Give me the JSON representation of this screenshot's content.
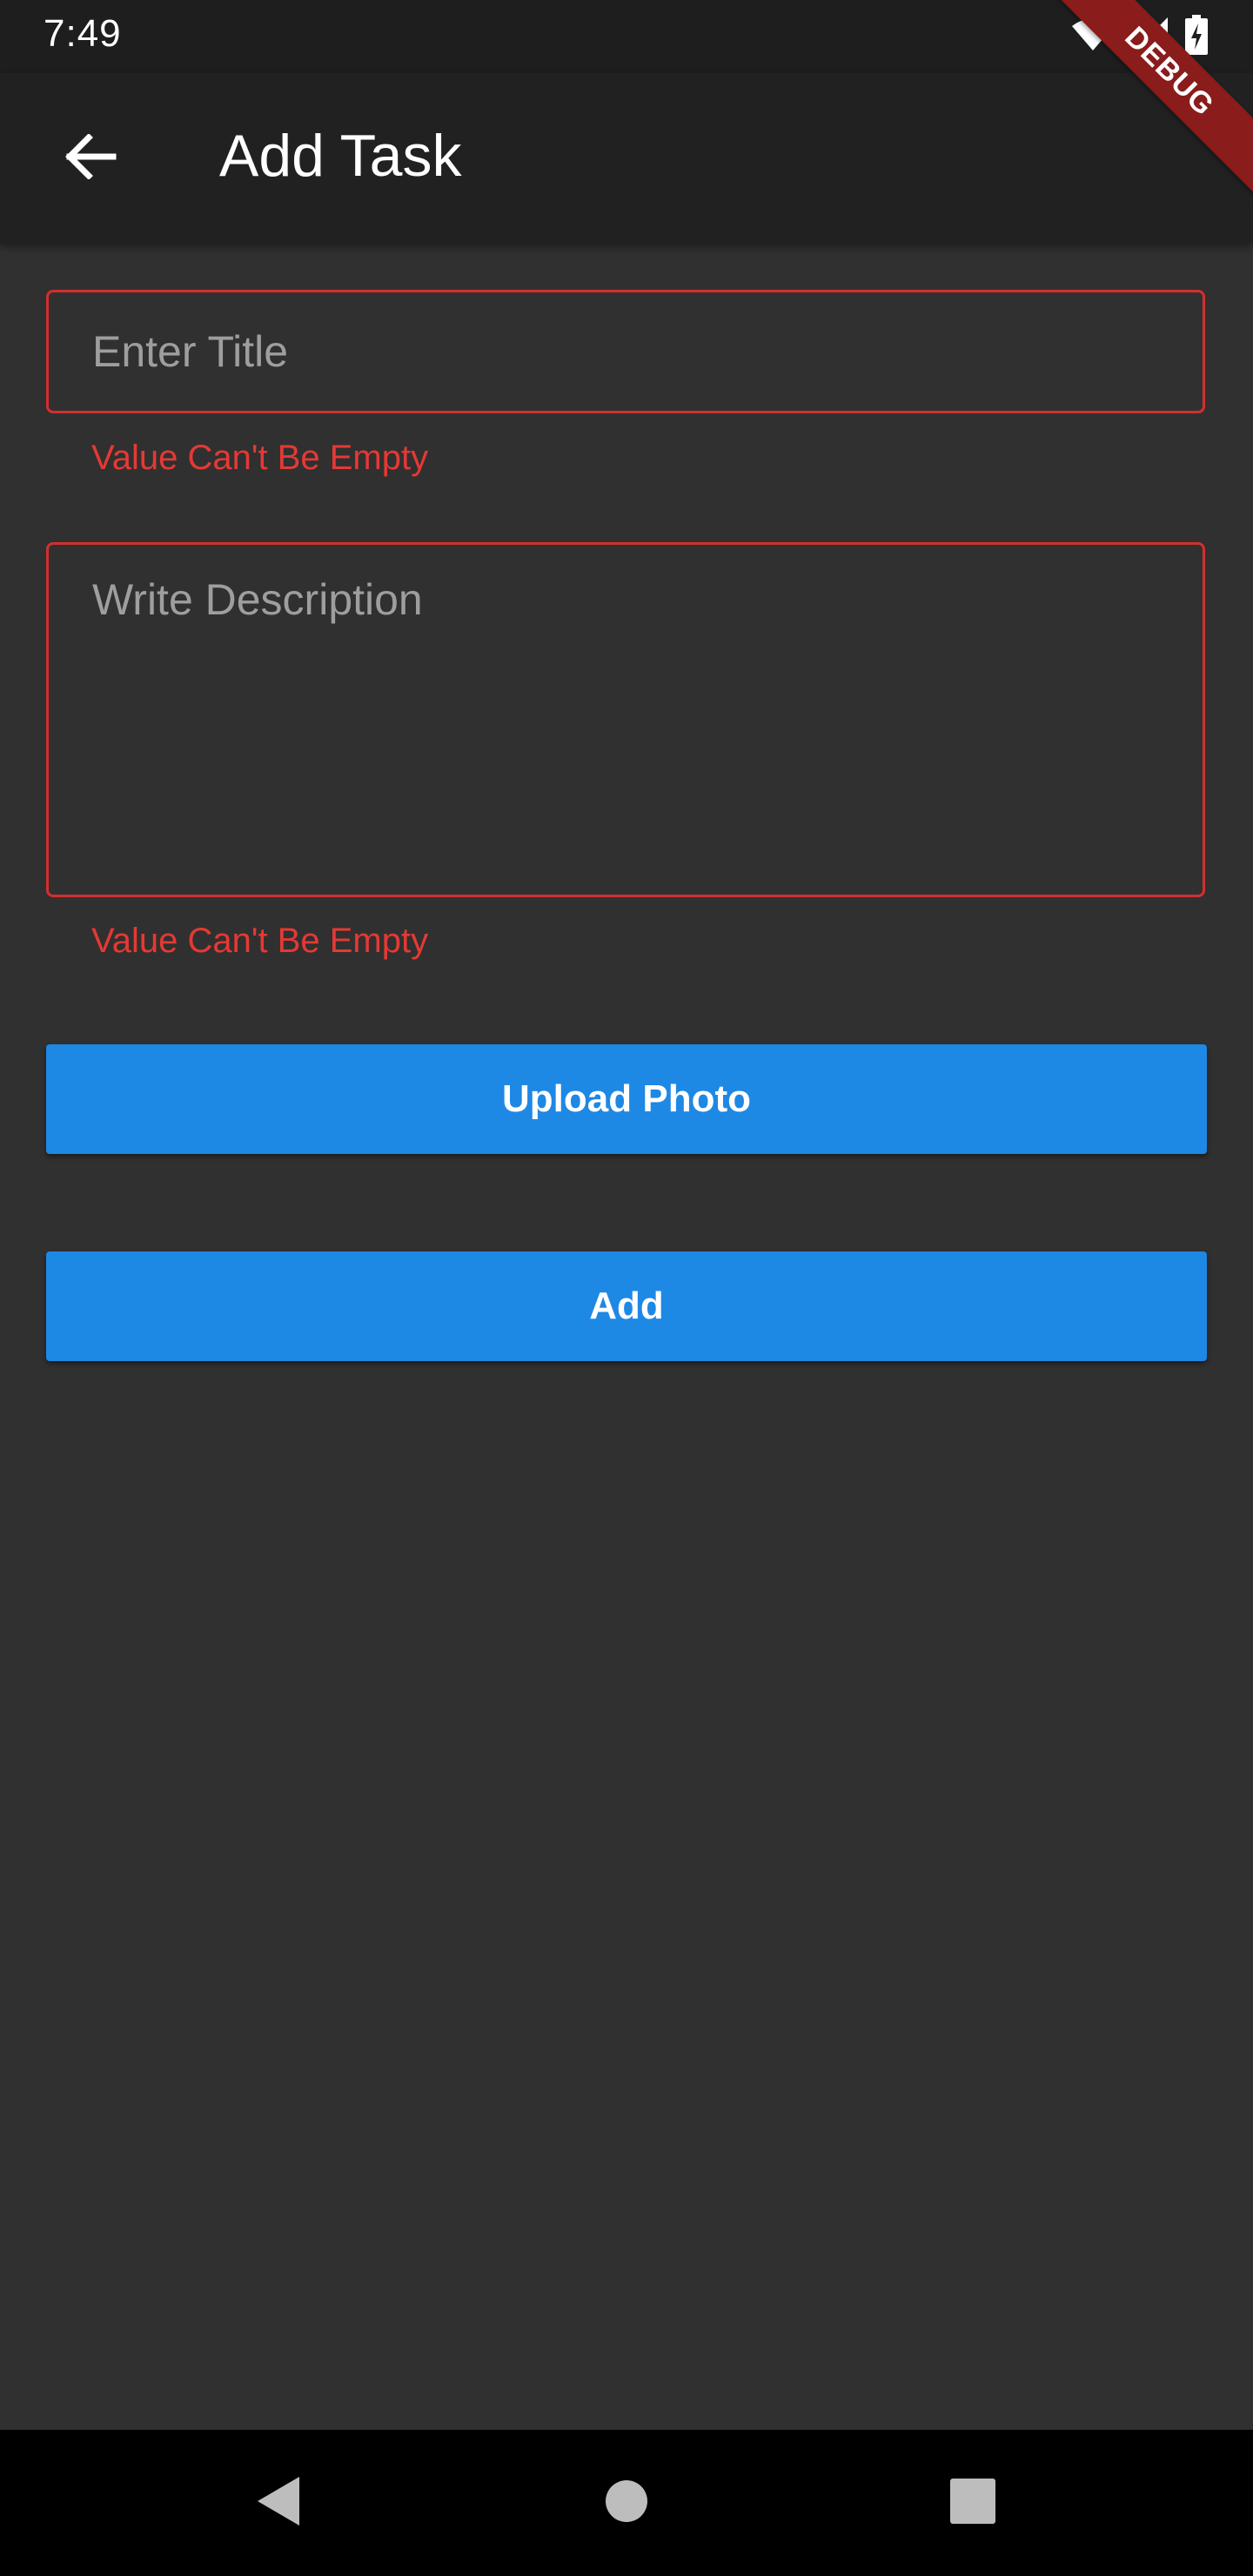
{
  "status_bar": {
    "time": "7:49",
    "icons": [
      "wifi-icon",
      "cell-signal-icon",
      "battery-charging-icon"
    ]
  },
  "app_bar": {
    "back_icon": "arrow-back-icon",
    "title": "Add Task"
  },
  "debug_banner": "DEBUG",
  "form": {
    "title_field": {
      "value": "",
      "placeholder": "Enter Title",
      "error": "Value Can't Be Empty"
    },
    "description_field": {
      "value": "",
      "placeholder": "Write Description",
      "error": "Value Can't Be Empty"
    },
    "upload_button_label": "Upload Photo",
    "add_button_label": "Add"
  },
  "nav_bar": {
    "icons": [
      "nav-back-icon",
      "nav-home-icon",
      "nav-recents-icon"
    ]
  },
  "colors": {
    "background": "#303030",
    "app_bar": "#212121",
    "status_bar": "#1e1e1e",
    "error": "#e53935",
    "accent": "#1e88e5",
    "debug_banner": "#8a1c1c"
  }
}
